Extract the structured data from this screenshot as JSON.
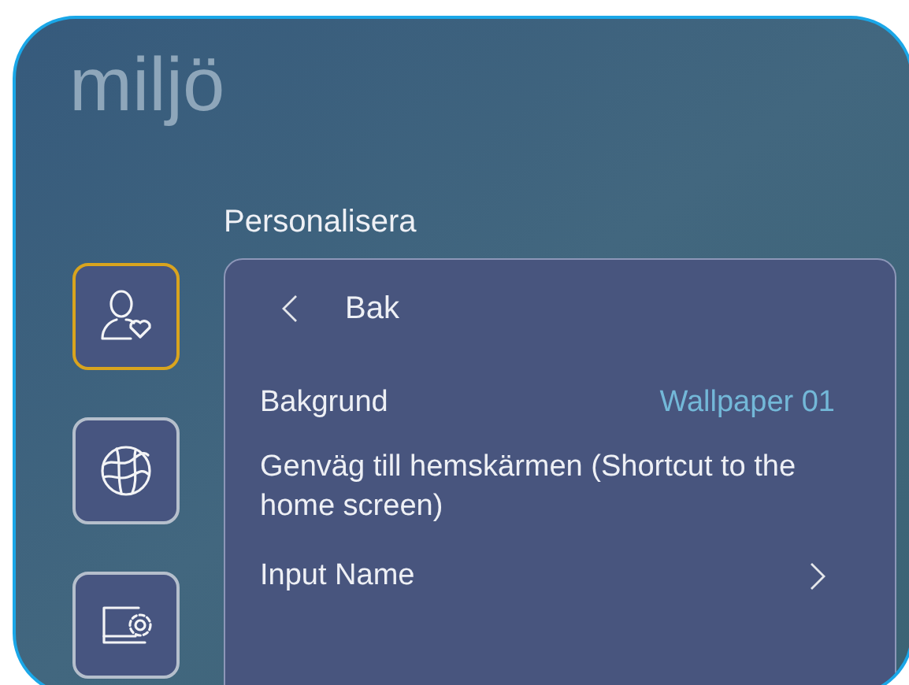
{
  "app_title": "miljö",
  "section_title": "Personalisera",
  "sidebar": {
    "items": [
      {
        "kind": "person-heart",
        "selected": true
      },
      {
        "kind": "globe",
        "selected": false
      },
      {
        "kind": "screen-gear",
        "selected": false
      }
    ]
  },
  "panel": {
    "rows": [
      {
        "kind": "back",
        "label": "Bak"
      },
      {
        "kind": "value",
        "label": "Bakgrund",
        "value": "Wallpaper 01"
      },
      {
        "kind": "text",
        "label": "Genväg till hemskärmen (Shortcut to the home screen)"
      },
      {
        "kind": "link",
        "label": "Input Name"
      }
    ]
  }
}
